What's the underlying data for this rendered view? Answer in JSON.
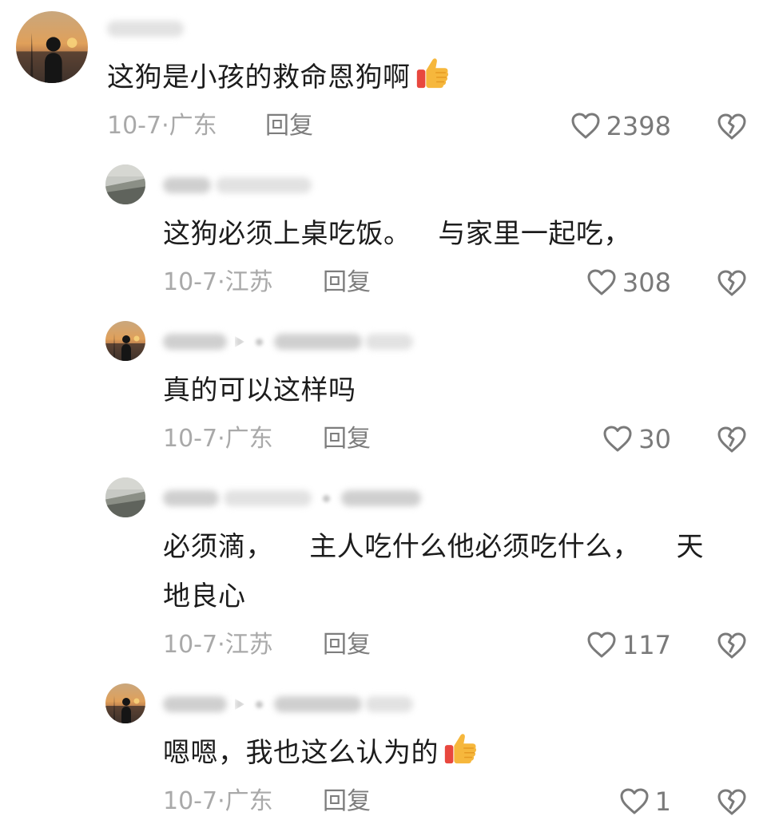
{
  "comments": [
    {
      "text": "这狗是小孩的救命恩狗啊",
      "has_emoji": true,
      "emoji": "thumbs-up",
      "date_location": "10-7·广东",
      "reply_label": "回复",
      "likes": "2398"
    },
    {
      "text": "这狗必须上桌吃饭。   与家里一起吃，",
      "date_location": "10-7·江苏",
      "reply_label": "回复",
      "likes": "308"
    },
    {
      "text": "真的可以这样吗",
      "date_location": "10-7·广东",
      "reply_label": "回复",
      "likes": "30"
    },
    {
      "text_line1": "必须滴，    主人吃什么他必须吃什么，    天",
      "text_line2": "地良心",
      "date_location": "10-7·江苏",
      "reply_label": "回复",
      "likes": "117"
    },
    {
      "text": "嗯嗯，我也这么认为的",
      "has_emoji": true,
      "emoji": "thumbs-up",
      "date_location": "10-7·广东",
      "reply_label": "回复",
      "likes": "1"
    }
  ],
  "icons": {
    "like": "heart-outline-icon",
    "dislike": "broken-heart-icon",
    "emoji": "thumbs-up-emoji"
  },
  "colors": {
    "text": "#1c1c1c",
    "meta": "#a9a9a9",
    "reply": "#7d7d7d",
    "icon": "#7a7a7a",
    "thumb_yellow": "#f6b73c",
    "thumb_red": "#e8473e"
  }
}
